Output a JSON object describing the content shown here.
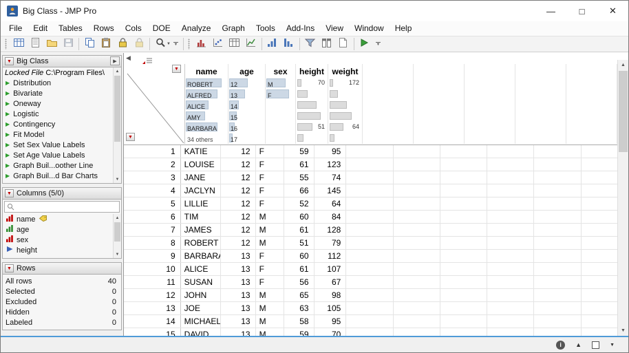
{
  "window": {
    "title": "Big Class - JMP Pro",
    "minimize": "—",
    "maximize": "□",
    "close": "✕"
  },
  "menu": [
    "File",
    "Edit",
    "Tables",
    "Rows",
    "Cols",
    "DOE",
    "Analyze",
    "Graph",
    "Tools",
    "Add-Ins",
    "View",
    "Window",
    "Help"
  ],
  "toolbar": [
    {
      "handle": true
    },
    {
      "name": "new-data-table",
      "type": "table",
      "color": "#4a76b8"
    },
    {
      "name": "new-journal",
      "type": "journal",
      "color": "#9a9a9a"
    },
    {
      "name": "open",
      "type": "folder",
      "color": "#c9a23a"
    },
    {
      "name": "save",
      "type": "floppy",
      "color": "#7d8fa3",
      "disabled": true
    },
    {
      "sep": true
    },
    {
      "name": "copy",
      "type": "copy",
      "color": "#4a76b8"
    },
    {
      "name": "paste",
      "type": "paste",
      "color": "#8a6d3b"
    },
    {
      "name": "lock-data-table",
      "type": "lock",
      "color": "#e8c84a"
    },
    {
      "name": "unlock-data-table",
      "type": "lock",
      "color": "#e8c84a",
      "disabled": true
    },
    {
      "sep": true
    },
    {
      "name": "search",
      "type": "magnifier",
      "color": "#444444",
      "dropdown": true
    },
    {
      "overflow": true
    },
    {
      "sep": true
    },
    {
      "handle": true
    },
    {
      "name": "distribution",
      "type": "bars",
      "color": "#b03a3a"
    },
    {
      "name": "fit-y-by-x",
      "type": "scatter",
      "color": "#3a62b8"
    },
    {
      "name": "tabulate",
      "type": "table",
      "color": "#777777"
    },
    {
      "name": "graph-builder",
      "type": "linechart",
      "color": "#3a8a3a"
    },
    {
      "sep": true
    },
    {
      "name": "sort-ascending",
      "type": "sortasc",
      "color": "#4a76b8"
    },
    {
      "name": "sort-descending",
      "type": "sortdesc",
      "color": "#4a76b8"
    },
    {
      "sep": true
    },
    {
      "name": "data-filter",
      "type": "funnel",
      "color": "#9ab8d8"
    },
    {
      "name": "column-switcher",
      "type": "cols",
      "color": "#777777"
    },
    {
      "name": "new-report",
      "type": "page",
      "color": "#888888"
    },
    {
      "sep": true
    },
    {
      "name": "run-script",
      "type": "play",
      "color": "#3a9e3a"
    },
    {
      "overflow": true
    }
  ],
  "sidebar": {
    "table_panel": {
      "title": "Big Class",
      "locked_label": "Locked File",
      "locked_path": "C:\\Program Files\\",
      "scripts": [
        "Distribution",
        "Bivariate",
        "Oneway",
        "Logistic",
        "Contingency",
        "Fit Model",
        "Set Sex Value Labels",
        "Set Age Value Labels",
        "Graph Buil...oother Line",
        "Graph Buil...d Bar Charts"
      ]
    },
    "columns_panel": {
      "title": "Columns (5/0)",
      "items": [
        {
          "label": "name",
          "role": "nominal",
          "tagged": true
        },
        {
          "label": "age",
          "role": "ordinal",
          "tagged": false
        },
        {
          "label": "sex",
          "role": "nominal",
          "tagged": false
        },
        {
          "label": "height",
          "role": "continuous",
          "tagged": false
        }
      ]
    },
    "rows_panel": {
      "title": "Rows",
      "stats": [
        {
          "label": "All rows",
          "value": "40"
        },
        {
          "label": "Selected",
          "value": "0"
        },
        {
          "label": "Excluded",
          "value": "0"
        },
        {
          "label": "Hidden",
          "value": "0"
        },
        {
          "label": "Labeled",
          "value": "0"
        }
      ]
    }
  },
  "table": {
    "columns": [
      "name",
      "age",
      "sex",
      "height",
      "weight"
    ],
    "header_graphs": {
      "name": [
        {
          "label": "ROBERT",
          "bar": 52
        },
        {
          "label": "ALFRED",
          "bar": 46
        },
        {
          "label": "ALICE",
          "bar": 33
        },
        {
          "label": "AMY",
          "bar": 28
        },
        {
          "label": "BARBARA",
          "bar": 46
        },
        {
          "label": "34 others",
          "bar": 0
        }
      ],
      "age": [
        {
          "label": "12",
          "bar": 27
        },
        {
          "label": "13",
          "bar": 23
        },
        {
          "label": "14",
          "bar": 14
        },
        {
          "label": "15",
          "bar": 11
        },
        {
          "label": "16",
          "bar": 8
        },
        {
          "label": "17",
          "bar": 5
        }
      ],
      "sex": [
        {
          "label": "M",
          "bar": 28
        },
        {
          "label": "F",
          "bar": 33
        }
      ],
      "height": {
        "max": "70",
        "min": "51",
        "bars": [
          6,
          15,
          28,
          34,
          22,
          9
        ]
      },
      "weight": {
        "max": "172",
        "min": "64",
        "bars": [
          5,
          12,
          25,
          32,
          20,
          7
        ]
      }
    },
    "rows": [
      {
        "n": "1",
        "name": "KATIE",
        "age": "12",
        "sex": "F",
        "height": "59",
        "weight": "95"
      },
      {
        "n": "2",
        "name": "LOUISE",
        "age": "12",
        "sex": "F",
        "height": "61",
        "weight": "123"
      },
      {
        "n": "3",
        "name": "JANE",
        "age": "12",
        "sex": "F",
        "height": "55",
        "weight": "74"
      },
      {
        "n": "4",
        "name": "JACLYN",
        "age": "12",
        "sex": "F",
        "height": "66",
        "weight": "145"
      },
      {
        "n": "5",
        "name": "LILLIE",
        "age": "12",
        "sex": "F",
        "height": "52",
        "weight": "64"
      },
      {
        "n": "6",
        "name": "TIM",
        "age": "12",
        "sex": "M",
        "height": "60",
        "weight": "84"
      },
      {
        "n": "7",
        "name": "JAMES",
        "age": "12",
        "sex": "M",
        "height": "61",
        "weight": "128"
      },
      {
        "n": "8",
        "name": "ROBERT",
        "age": "12",
        "sex": "M",
        "height": "51",
        "weight": "79"
      },
      {
        "n": "9",
        "name": "BARBARA",
        "age": "13",
        "sex": "F",
        "height": "60",
        "weight": "112"
      },
      {
        "n": "10",
        "name": "ALICE",
        "age": "13",
        "sex": "F",
        "height": "61",
        "weight": "107"
      },
      {
        "n": "11",
        "name": "SUSAN",
        "age": "13",
        "sex": "F",
        "height": "56",
        "weight": "67"
      },
      {
        "n": "12",
        "name": "JOHN",
        "age": "13",
        "sex": "M",
        "height": "65",
        "weight": "98"
      },
      {
        "n": "13",
        "name": "JOE",
        "age": "13",
        "sex": "M",
        "height": "63",
        "weight": "105"
      },
      {
        "n": "14",
        "name": "MICHAEL",
        "age": "13",
        "sex": "M",
        "height": "58",
        "weight": "95"
      },
      {
        "n": "15",
        "name": "DAVID",
        "age": "13",
        "sex": "M",
        "height": "59",
        "weight": "70"
      }
    ]
  }
}
